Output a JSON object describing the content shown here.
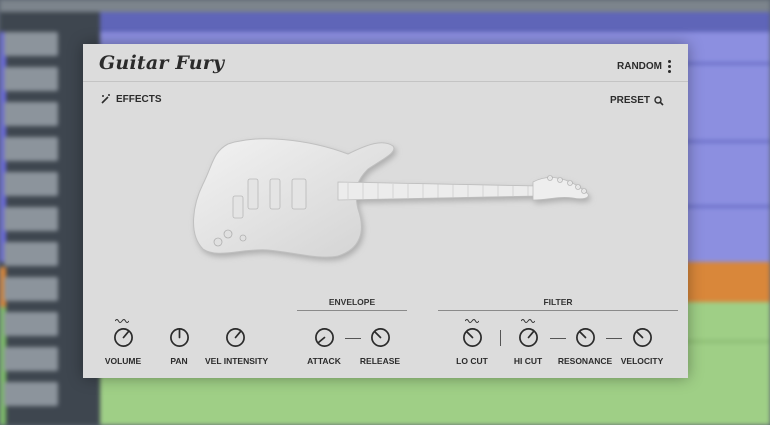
{
  "app": {
    "title": "Guitar Fury"
  },
  "header": {
    "random_label": "RANDOM"
  },
  "toolbar": {
    "effects_label": "EFFECTS",
    "preset_label": "PRESET"
  },
  "sections": {
    "envelope": "ENVELOPE",
    "filter": "FILTER"
  },
  "knobs": [
    {
      "label": "VOLUME",
      "icon": "knob-icon"
    },
    {
      "label": "PAN",
      "icon": "knob-icon"
    },
    {
      "label": "VEL INTENSITY",
      "icon": "knob-icon"
    },
    {
      "label": "ATTACK",
      "icon": "knob-icon"
    },
    {
      "label": "RELEASE",
      "icon": "knob-icon"
    },
    {
      "label": "LO CUT",
      "icon": "knob-icon"
    },
    {
      "label": "HI CUT",
      "icon": "knob-icon"
    },
    {
      "label": "RESONANCE",
      "icon": "knob-icon"
    },
    {
      "label": "VELOCITY",
      "icon": "knob-icon"
    }
  ],
  "colors": {
    "panel": "#dcdcdc",
    "text": "#2b2b2b",
    "daw_purple": "#8c8fe0",
    "daw_green": "#9fcf86",
    "daw_orange": "#d9873a"
  }
}
